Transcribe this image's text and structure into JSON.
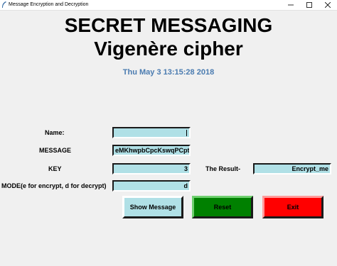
{
  "window": {
    "title": "Message Encryption and Decryption",
    "controls": [
      "minimize-icon",
      "maximize-icon",
      "close-icon"
    ]
  },
  "header": {
    "title": "SECRET MESSAGING",
    "subtitle": "Vigenère cipher",
    "datetime": "Thu May  3 13:15:28 2018"
  },
  "form": {
    "name_label": "Name:",
    "name_value": "",
    "message_label": "MESSAGE",
    "message_value": "eMKhwpbCpcKswqPCpt",
    "key_label": "KEY",
    "key_value": "3",
    "mode_label": "MODE(e for encrypt, d for decrypt)",
    "mode_value": "d",
    "result_label": "The Result-",
    "result_value": "Encrypt_me"
  },
  "buttons": {
    "show_label": "Show Message",
    "reset_label": "Reset",
    "exit_label": "Exit"
  },
  "colors": {
    "entry_bg": "#b0e0e6",
    "date_text": "#4a7bb0",
    "reset_bg": "#008000",
    "exit_bg": "#ff0000"
  }
}
